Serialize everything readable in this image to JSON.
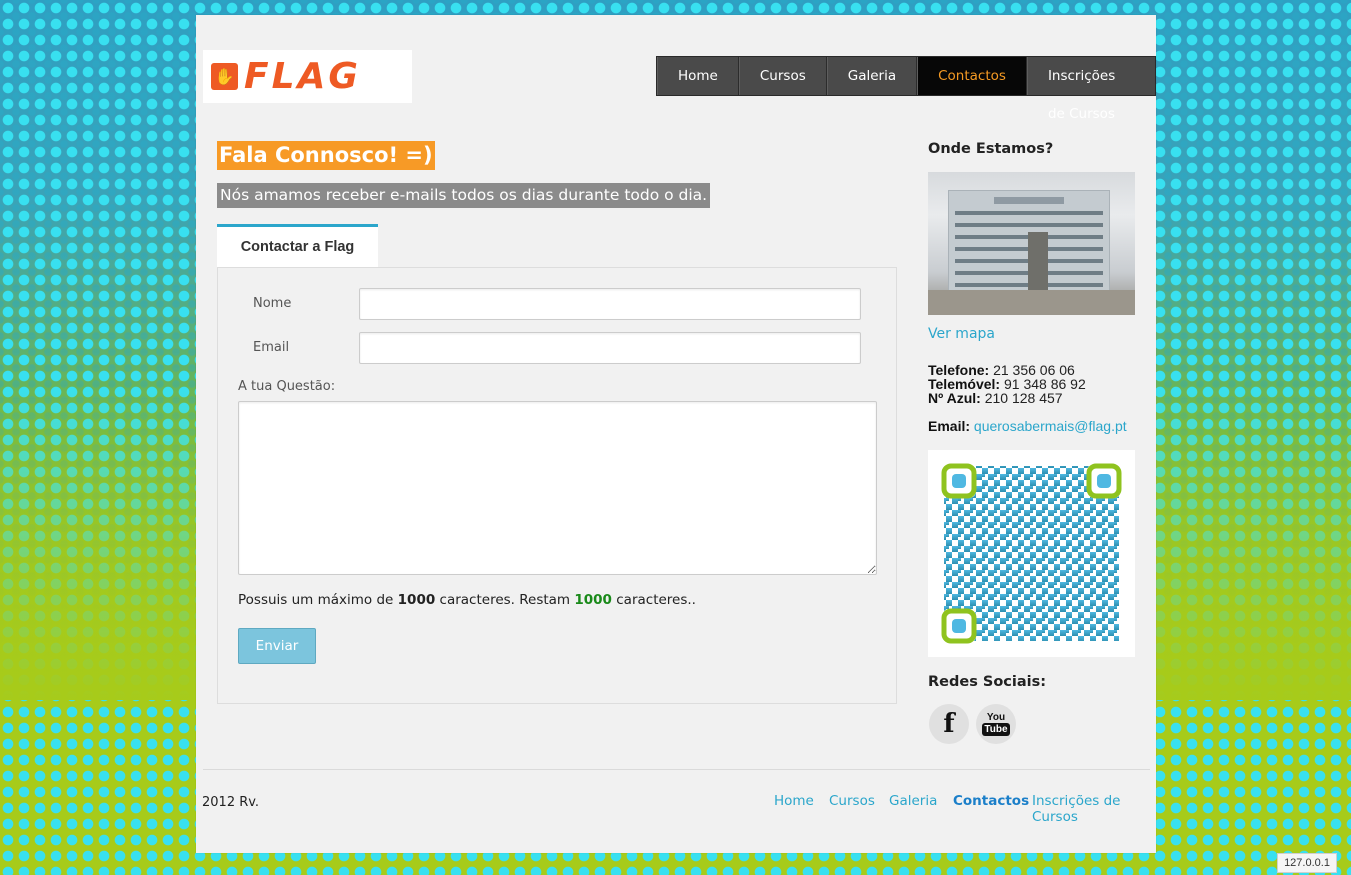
{
  "logo": {
    "text": "FLAG"
  },
  "nav": {
    "items": [
      {
        "label": "Home"
      },
      {
        "label": "Cursos"
      },
      {
        "label": "Galeria"
      },
      {
        "label": "Contactos",
        "active": true
      },
      {
        "label": "Inscrições de Cursos"
      }
    ]
  },
  "main": {
    "title": "Fala Connosco! =)",
    "subtitle": "Nós amamos receber e-mails todos os dias durante todo o dia.",
    "tab_label": "Contactar a Flag",
    "form": {
      "name_label": "Nome",
      "name_value": "",
      "email_label": "Email",
      "email_value": "",
      "question_label": "A tua Questão:",
      "question_value": "",
      "counter_prefix": "Possuis um máximo de",
      "counter_max": "1000",
      "counter_middle": "caracteres. Restam",
      "counter_remaining": "1000",
      "counter_suffix": "caracteres..",
      "submit_label": "Enviar"
    }
  },
  "sidebar": {
    "location_heading": "Onde Estamos?",
    "map_link": "Ver mapa",
    "phone_label": "Telefone:",
    "phone_value": "21 356 06 06",
    "mobile_label": "Telemóvel:",
    "mobile_value": "91 348 86 92",
    "azul_label": "Nº Azul:",
    "azul_value": "210 128 457",
    "email_label": "Email:",
    "email_value": "querosabermais@flag.pt",
    "social_heading": "Redes Sociais:",
    "facebook_glyph": "f",
    "youtube_top": "You",
    "youtube_bottom": "Tube"
  },
  "footer": {
    "copyright": "2012 Rv.",
    "links": [
      {
        "label": "Home"
      },
      {
        "label": "Cursos"
      },
      {
        "label": "Galeria"
      },
      {
        "label": "Contactos",
        "active": true
      },
      {
        "label": "Inscrições de Cursos"
      }
    ]
  },
  "status": {
    "ip": "127.0.0.1"
  },
  "colors": {
    "accent": "#2ba6cb",
    "brand_orange": "#ee5a24",
    "nav_active_text": "#f59a23",
    "button": "#7cc5dd"
  }
}
